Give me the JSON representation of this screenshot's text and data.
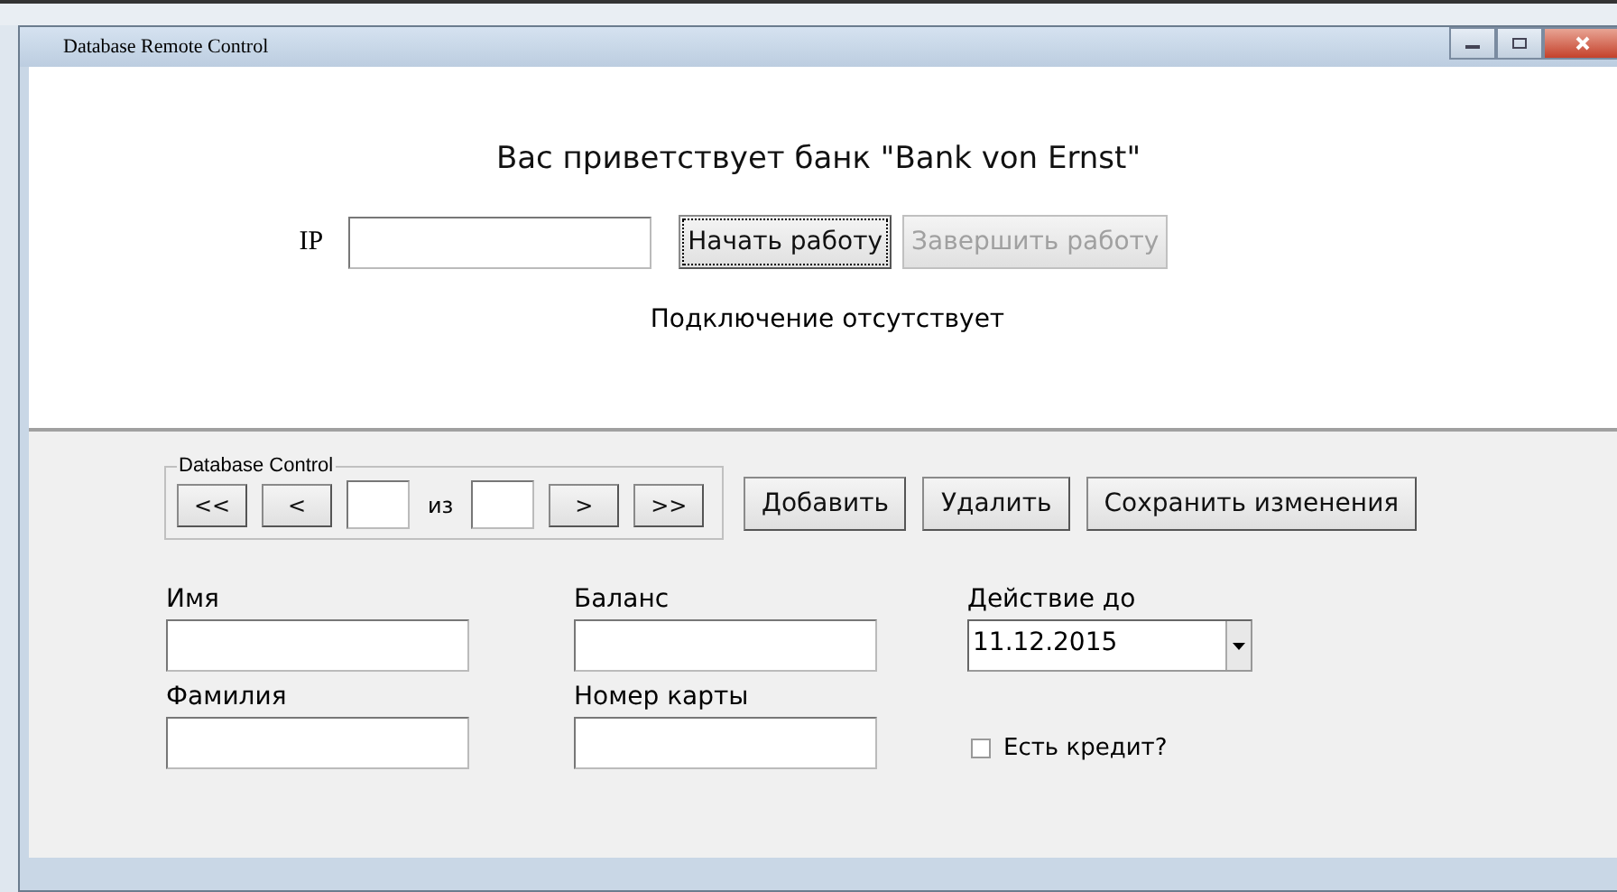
{
  "window": {
    "title": "Database Remote Control"
  },
  "welcome": "Вас приветствует банк \"Bank von Ernst\"",
  "connection": {
    "ip_label": "IP",
    "buttons": [
      {
        "label": "Начать работу",
        "disabled": false,
        "focused": true
      },
      {
        "label": "Завершить работу",
        "disabled": true,
        "focused": false
      }
    ],
    "status": "Подключение отсутствует"
  },
  "database_control": {
    "title": "Database Control",
    "nav": [
      {
        "kind": "button",
        "label": "<<"
      },
      {
        "kind": "button",
        "label": "<"
      },
      {
        "kind": "field"
      },
      {
        "kind": "text",
        "label": "из"
      },
      {
        "kind": "field"
      },
      {
        "kind": "button",
        "label": ">"
      },
      {
        "kind": "button",
        "label": ">>"
      }
    ]
  },
  "actions": [
    "Добавить",
    "Удалить",
    "Сохранить изменения"
  ],
  "fields": [
    {
      "kind": "text",
      "label": "Имя"
    },
    {
      "kind": "text",
      "label": "Баланс"
    },
    {
      "kind": "combo",
      "label": "Действие до",
      "value": "11.12.2015"
    },
    {
      "kind": "text",
      "label": "Фамилия"
    },
    {
      "kind": "text",
      "label": "Номер карты"
    },
    {
      "kind": "checkbox",
      "label": "Есть кредит?",
      "checked": false
    }
  ]
}
